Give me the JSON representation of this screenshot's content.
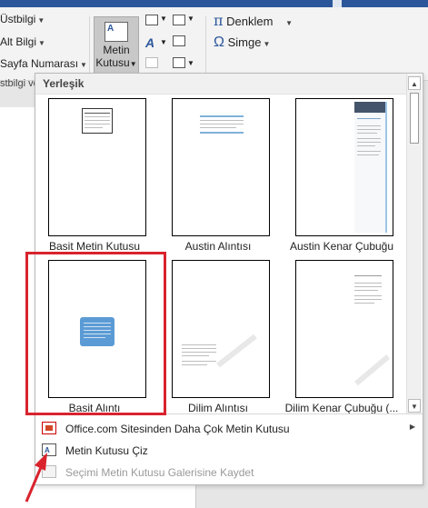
{
  "ribbon": {
    "ustbilgi": "Üstbilgi",
    "altbilgi": "Alt Bilgi",
    "sayfa_numarasi": "Sayfa Numarası",
    "group_label": "stbilgi ve",
    "metin_kutusu_line1": "Metin",
    "metin_kutusu_line2": "Kutusu",
    "denklem": "Denklem",
    "simge": "Simge",
    "pi_glyph": "π",
    "omega_glyph": "Ω",
    "a_glyph": "A"
  },
  "gallery": {
    "section_title": "Yerleşik",
    "tiles": [
      {
        "caption": "Basit Metin Kutusu"
      },
      {
        "caption": "Austin Alıntısı"
      },
      {
        "caption": "Austin Kenar Çubuğu"
      },
      {
        "caption": "Basit Alıntı"
      },
      {
        "caption": "Dilim Alıntısı"
      },
      {
        "caption": "Dilim Kenar Çubuğu (..."
      }
    ],
    "selected_tile": "Basit Alıntı"
  },
  "commands": [
    {
      "label": "Office.com Sitesinden Daha Çok Metin Kutusu",
      "has_submenu": true,
      "enabled": true
    },
    {
      "label": "Metin Kutusu Çiz",
      "has_submenu": false,
      "enabled": true
    },
    {
      "label": "Seçimi Metin Kutusu Galerisine Kaydet",
      "has_submenu": false,
      "enabled": false
    }
  ],
  "colors": {
    "title_bar": "#2b579a",
    "selection_border": "#d9232d",
    "annotation_arrow": "#d9232d",
    "quote_box": "#5b9bd5"
  },
  "icons": [
    "caret-down-icon",
    "text-box-icon",
    "pi-icon",
    "omega-icon",
    "wordart-icon",
    "office-icon",
    "draw-textbox-icon",
    "save-selection-icon",
    "scroll-up-icon",
    "scroll-down-icon",
    "submenu-arrow-icon"
  ]
}
